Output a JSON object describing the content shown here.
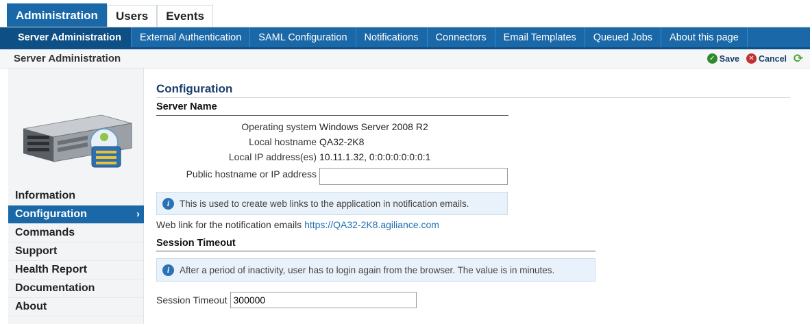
{
  "top_tabs": [
    {
      "label": "Administration",
      "active": true
    },
    {
      "label": "Users",
      "active": false
    },
    {
      "label": "Events",
      "active": false
    }
  ],
  "sub_nav": [
    {
      "label": "Server Administration",
      "active": true
    },
    {
      "label": "External Authentication",
      "active": false
    },
    {
      "label": "SAML Configuration",
      "active": false
    },
    {
      "label": "Notifications",
      "active": false
    },
    {
      "label": "Connectors",
      "active": false
    },
    {
      "label": "Email Templates",
      "active": false
    },
    {
      "label": "Queued Jobs",
      "active": false
    },
    {
      "label": "About this page",
      "active": false
    }
  ],
  "breadcrumb": {
    "title": "Server Administration",
    "save_label": "Save",
    "cancel_label": "Cancel"
  },
  "sidebar": {
    "items": [
      {
        "label": "Information"
      },
      {
        "label": "Configuration",
        "active": true
      },
      {
        "label": "Commands"
      },
      {
        "label": "Support"
      },
      {
        "label": "Health Report"
      },
      {
        "label": "Documentation"
      },
      {
        "label": "About"
      }
    ]
  },
  "main": {
    "title": "Configuration",
    "server_name": {
      "heading": "Server Name",
      "os_label": "Operating system",
      "os_value": "Windows Server 2008 R2",
      "hostname_label": "Local hostname",
      "hostname_value": "QA32-2K8",
      "ip_label": "Local IP address(es)",
      "ip_value": "10.11.1.32, 0:0:0:0:0:0:0:1",
      "public_label": "Public hostname or IP address",
      "public_value": "",
      "info_text": "This is used to create web links to the application in notification emails.",
      "weblink_label": "Web link for the notification emails",
      "weblink_value": "https://QA32-2K8.agiliance.com"
    },
    "session": {
      "heading": "Session Timeout",
      "info_text": "After a period of inactivity, user has to login again from the browser. The value is in minutes.",
      "timeout_label": "Session Timeout",
      "timeout_value": "300000"
    }
  },
  "colors": {
    "accent": "#1a68a8",
    "accent_dark": "#0e4f85",
    "title": "#1a3f6b",
    "info_bg": "#e9f2fa",
    "link": "#1f6fb2"
  }
}
